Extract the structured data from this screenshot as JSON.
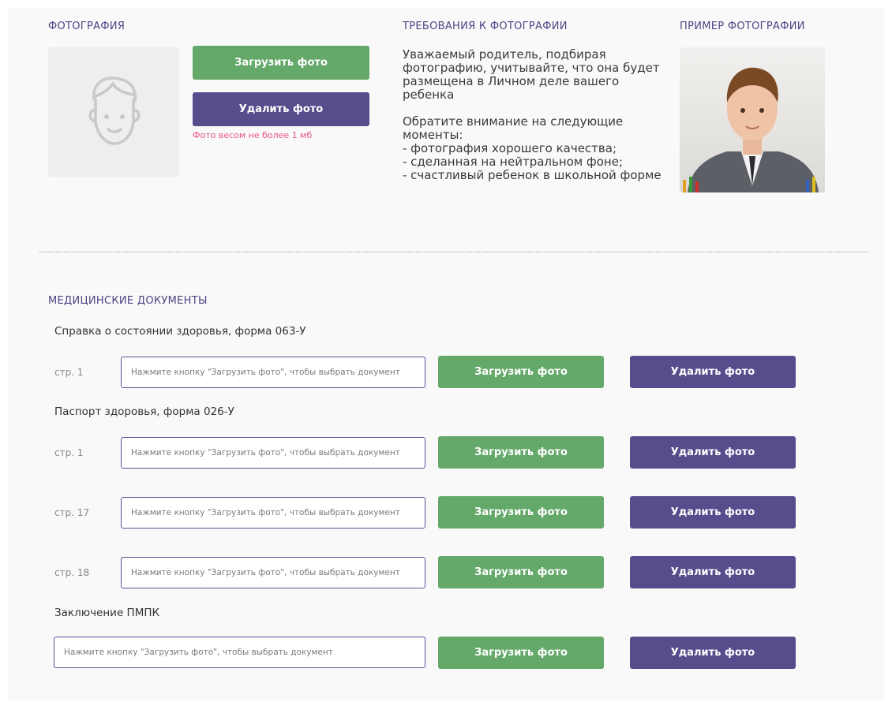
{
  "photo_section": {
    "title": "ФОТОГРАФИЯ",
    "placeholder_icon": "boy-face-icon",
    "upload_label": "Загрузить фото",
    "delete_label": "Удалить фото",
    "hint": "Фото весом не более 1 мб"
  },
  "requirements": {
    "title": "ТРЕБОВАНИЯ К ФОТОГРАФИИ",
    "text": "Уважаемый родитель, подбирая фотографию, учитывайте, что она будет размещена в Личном деле вашего ребенка\n\nОбратите внимание на следующие моменты:\n- фотография хорошего качества;\n- сделанная на нейтральном фоне;\n- счастливый ребенок в школьной форме"
  },
  "example": {
    "title": "ПРИМЕР ФОТОГРАФИИ",
    "image": "example-child-photo"
  },
  "medical": {
    "title": "МЕДИЦИНСКИЕ ДОКУМЕНТЫ",
    "placeholder": "Нажмите кнопку \"Загрузить фото\", чтобы выбрать документ",
    "upload_label": "Загрузить фото",
    "delete_label": "Удалить фото",
    "groups": [
      {
        "title": "Справка о состоянии здоровья, форма 063-У",
        "pages": [
          "стр. 1"
        ]
      },
      {
        "title": "Паспорт здоровья, форма 026-У",
        "pages": [
          "стр. 1",
          "стр. 17",
          "стр. 18"
        ]
      },
      {
        "title": "Заключение ПМПК",
        "pages": [
          ""
        ]
      }
    ]
  },
  "colors": {
    "green": "#64a86a",
    "purple": "#574c8c",
    "title": "#4e4585",
    "hint": "#e6548a"
  }
}
